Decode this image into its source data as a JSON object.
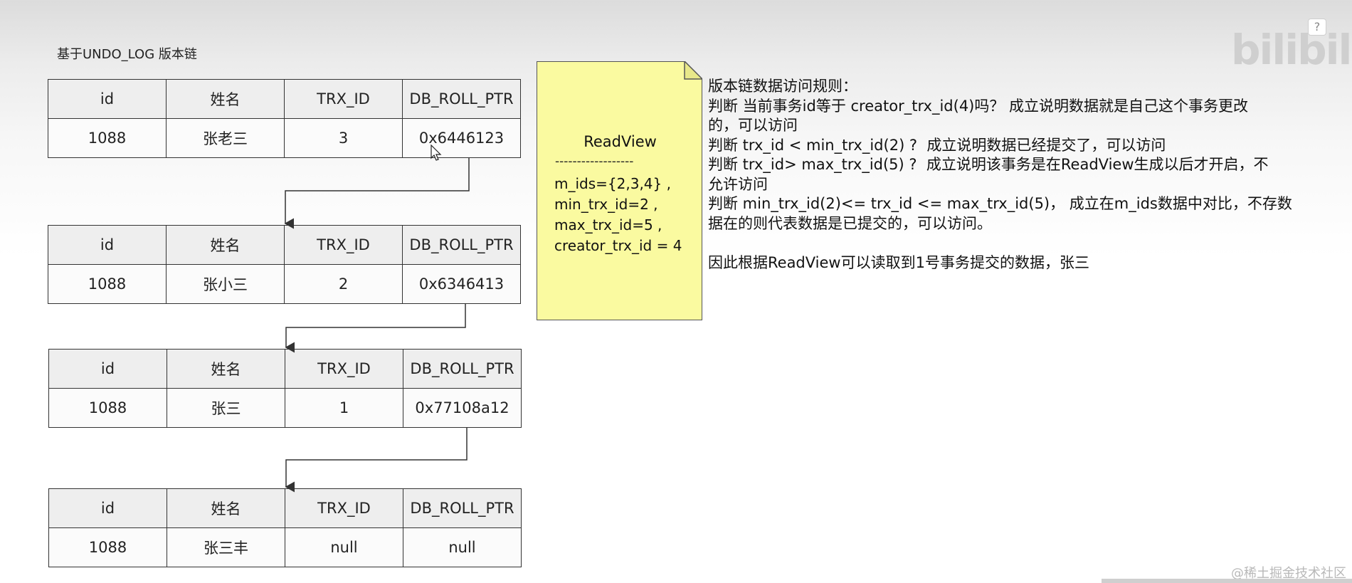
{
  "title": "基于UNDO_LOG 版本链",
  "columns": [
    "id",
    "姓名",
    "TRX_ID",
    "DB_ROLL_PTR"
  ],
  "records": [
    {
      "id": "1088",
      "name": "张老三",
      "trx_id": "3",
      "roll_ptr": "0x6446123"
    },
    {
      "id": "1088",
      "name": "张小三",
      "trx_id": "2",
      "roll_ptr": "0x6346413"
    },
    {
      "id": "1088",
      "name": "张三",
      "trx_id": "1",
      "roll_ptr": "0x77108a12"
    },
    {
      "id": "1088",
      "name": "张三丰",
      "trx_id": "null",
      "roll_ptr": "null"
    }
  ],
  "readview": {
    "title": "ReadView",
    "separator": "------------------",
    "lines": [
      "m_ids={2,3,4} ,",
      "min_trx_id=2  ,",
      "max_trx_id=5  ,",
      "creator_trx_id = 4"
    ]
  },
  "rules": {
    "lines": [
      "版本链数据访问规则：",
      "判断 当前事务id等于 creator_trx_id(4)吗？ 成立说明数据就是自己这个事务更改",
      "的，可以访问",
      "判断 trx_id < min_trx_id(2) ?  成立说明数据已经提交了，可以访问",
      "判断 trx_id> max_trx_id(5) ?  成立说明该事务是在ReadView生成以后才开启，不",
      "允许访问",
      "判断 min_trx_id(2)<= trx_id <= max_trx_id(5)， 成立在m_ids数据中对比，不存数",
      "据在的则代表数据是已提交的，可以访问。"
    ],
    "conclusion": "因此根据ReadView可以读取到1号事务提交的数据，张三"
  },
  "logo": "bilibili",
  "help_label": "?",
  "watermark": "@稀土掘金技术社区"
}
